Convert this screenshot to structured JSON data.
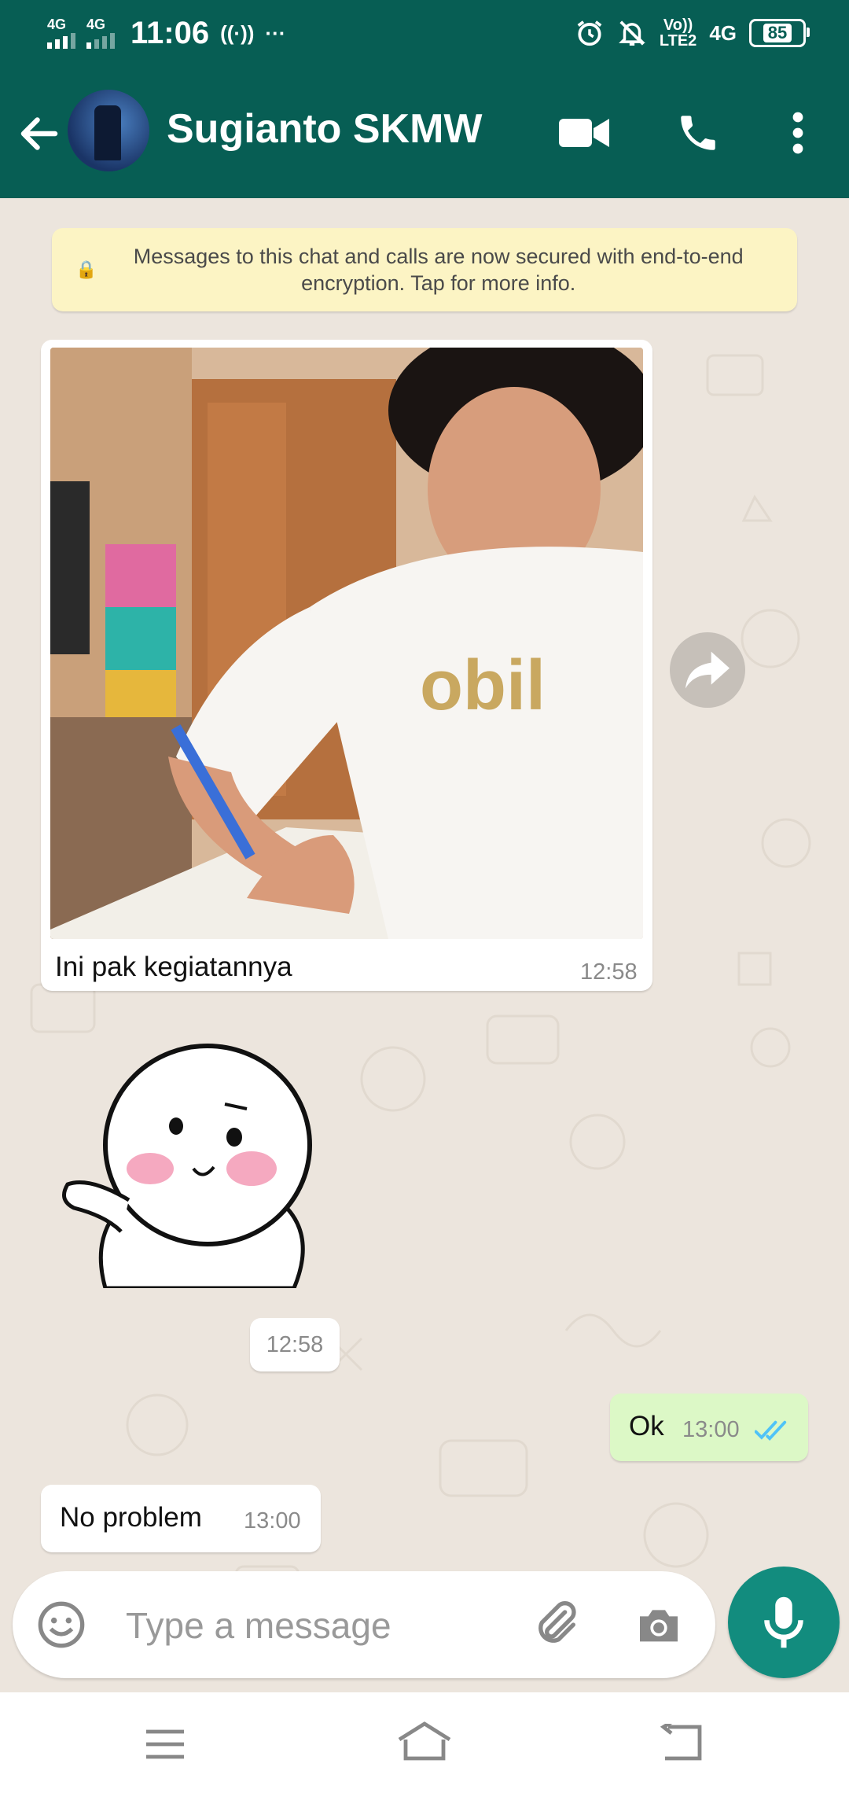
{
  "status_bar": {
    "net1": "4G",
    "net2": "4G",
    "time": "11:06",
    "hotspot": "((·))",
    "more": "···",
    "volte": "Vo))",
    "lte2": "LTE2",
    "net3": "4G",
    "battery": "85"
  },
  "header": {
    "contact_name": "Sugianto SKMW"
  },
  "chat": {
    "encryption_notice": "Messages to this chat and calls are now secured with end-to-end encryption. Tap for more info.",
    "messages": [
      {
        "caption": "Ini pak kegiatannya",
        "time": "12:58"
      },
      {
        "time": "12:58"
      },
      {
        "text": "Ok",
        "time": "13:00"
      },
      {
        "text": "No problem",
        "time": "13:00"
      }
    ]
  },
  "composer": {
    "placeholder": "Type a message"
  },
  "colors": {
    "header": "#075e54",
    "outgoing_bubble": "#dcf8c6",
    "mic_button": "#128c7e",
    "read_ticks": "#4fc3f7"
  }
}
